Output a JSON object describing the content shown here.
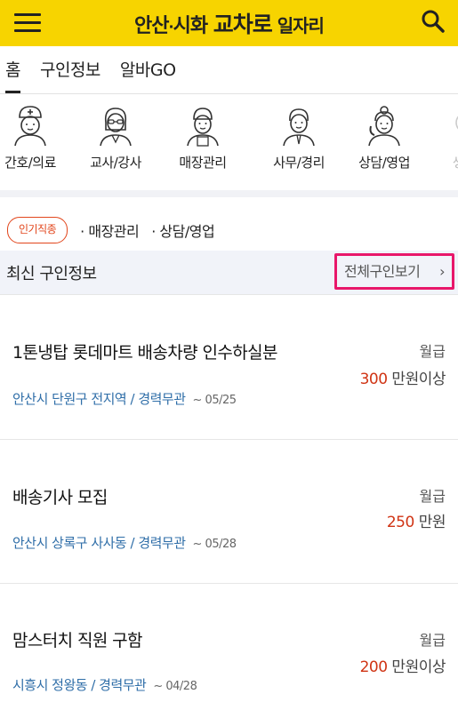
{
  "header": {
    "logo_a": "안산",
    "logo_dot": "·",
    "logo_b": "시화 ",
    "logo_em": "교차로",
    "logo_tail": " 일자리"
  },
  "tabs": [
    {
      "label": "홈",
      "active": true
    },
    {
      "label": "구인정보",
      "active": false
    },
    {
      "label": "알바GO",
      "active": false
    }
  ],
  "categories": [
    {
      "label": "간호/의료",
      "icon": "nurse-icon"
    },
    {
      "label": "교사/강사",
      "icon": "teacher-icon"
    },
    {
      "label": "매장관리",
      "icon": "store-manager-icon"
    },
    {
      "label": "사무/경리",
      "icon": "office-worker-icon"
    },
    {
      "label": "상담/영업",
      "icon": "call-agent-icon"
    },
    {
      "label": "생산",
      "icon": "production-icon"
    }
  ],
  "popular": {
    "badge": "인기직종",
    "items": [
      "매장관리",
      "상담/영업"
    ]
  },
  "latest": {
    "title": "최신 구인정보",
    "view_all": "전체구인보기",
    "chevron": "›"
  },
  "jobs": [
    {
      "title": "1톤냉탑 롯데마트 배송차량 인수하실분",
      "location": "안산시 단원구 전지역 / 경력무관",
      "date": "~ 05/25",
      "pay_type": "월급",
      "amount": "300",
      "unit": " 만원이상"
    },
    {
      "title": "배송기사 모집",
      "location": "안산시 상록구 사사동 / 경력무관",
      "date": "~ 05/28",
      "pay_type": "월급",
      "amount": "250",
      "unit": " 만원"
    },
    {
      "title": "맘스터치 직원 구함",
      "location": "시흥시 정왕동 / 경력무관",
      "date": "~ 04/28",
      "pay_type": "월급",
      "amount": "200",
      "unit": " 만원이상"
    }
  ],
  "colors": {
    "brand": "#f7d400",
    "accent": "#e2461c",
    "highlight": "#e8176a",
    "link": "#2f6ea8",
    "pay": "#d03414"
  }
}
